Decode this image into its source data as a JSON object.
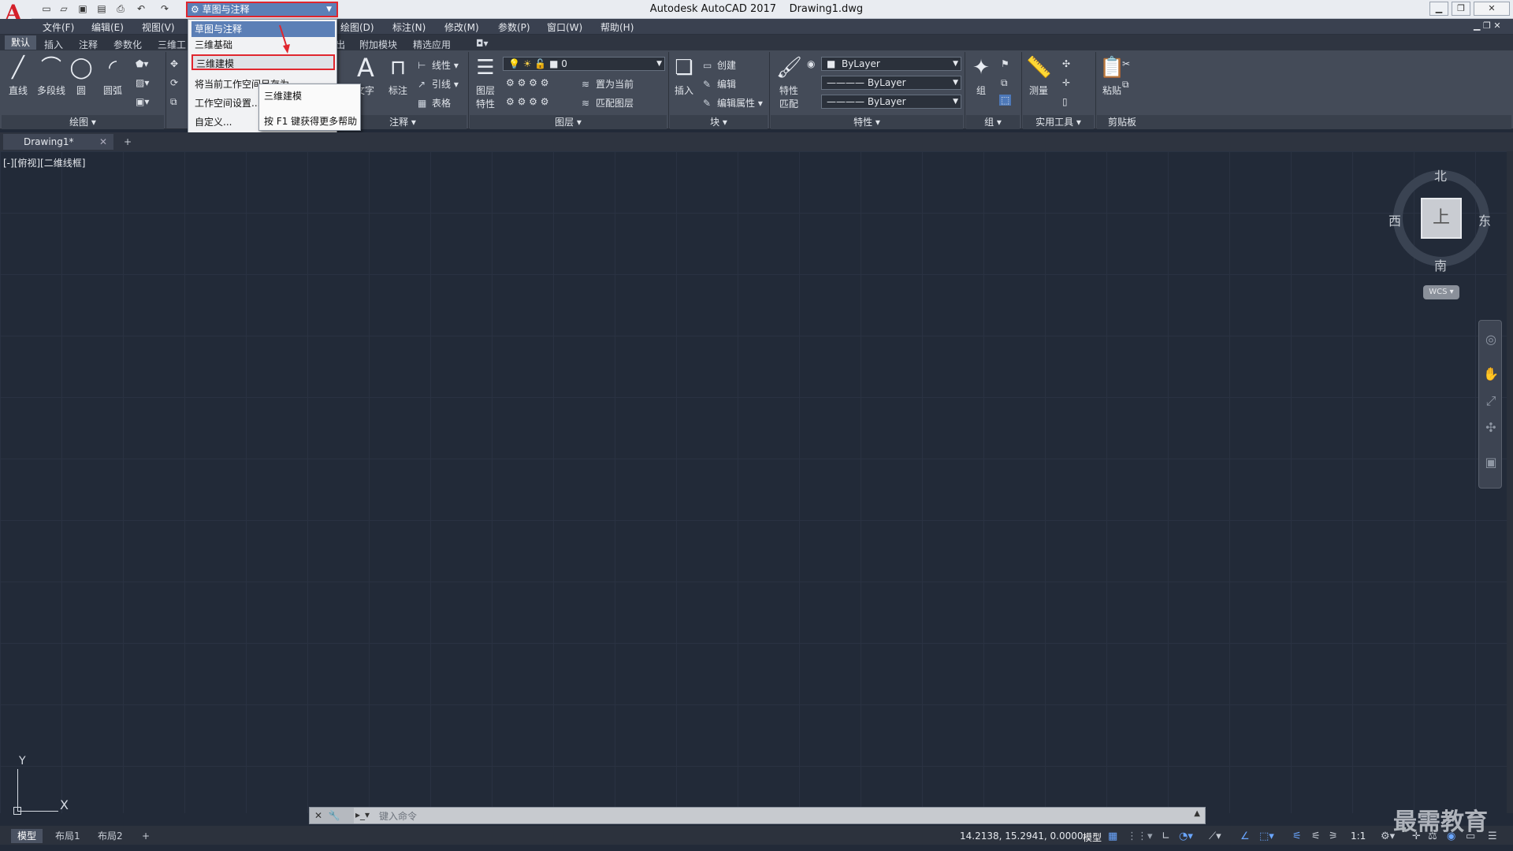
{
  "app": {
    "title": "Autodesk AutoCAD 2017",
    "file": "Drawing1.dwg"
  },
  "workspace": {
    "current": "草图与注释"
  },
  "menu": [
    "文件(F)",
    "编辑(E)",
    "视图(V)",
    "绘图(D)",
    "标注(N)",
    "修改(M)",
    "参数(P)",
    "窗口(W)",
    "帮助(H)"
  ],
  "ribbon_tabs": [
    "默认",
    "插入",
    "注释",
    "参数化",
    "三维工",
    "输出",
    "附加模块",
    "精选应用"
  ],
  "dropdown": {
    "items": [
      "草图与注释",
      "三维基础",
      "三维建模",
      "将当前工作空间另存为...",
      "工作空间设置...",
      "自定义..."
    ],
    "tooltip_title": "三维建模",
    "tooltip_help": "按 F1 键获得更多帮助"
  },
  "ribbon": {
    "draw": {
      "line": "直线",
      "polyline": "多段线",
      "circle": "圆",
      "arc": "圆弧",
      "panel": "绘图"
    },
    "annotation": {
      "text": "文字",
      "dim": "标注",
      "linear": "线性",
      "leader": "引线",
      "table": "表格",
      "panel": "注释"
    },
    "layers": {
      "props_line1": "图层",
      "props_line2": "特性",
      "current_layer": "0",
      "set_current": "置为当前",
      "match": "匹配图层",
      "panel": "图层"
    },
    "block": {
      "insert": "插入",
      "create": "创建",
      "edit": "编辑",
      "edit_attr": "编辑属性",
      "panel": "块"
    },
    "properties": {
      "match_line1": "特性",
      "match_line2": "匹配",
      "color": "ByLayer",
      "linetype": "ByLayer",
      "lineweight": "ByLayer",
      "panel": "特性"
    },
    "groups": {
      "group": "组",
      "panel": "组"
    },
    "utilities": {
      "measure": "测量",
      "panel": "实用工具"
    },
    "clipboard": {
      "paste": "粘贴",
      "panel": "剪贴板"
    }
  },
  "doc_tab": "Drawing1*",
  "viewport_label": "[-][俯视][二维线框]",
  "viewcube": {
    "n": "北",
    "s": "南",
    "e": "东",
    "w": "西",
    "face": "上",
    "wcs": "WCS"
  },
  "ucs": {
    "x": "X",
    "y": "Y"
  },
  "command": {
    "placeholder": "键入命令"
  },
  "layout_tabs": [
    "模型",
    "布局1",
    "布局2"
  ],
  "status": {
    "coords": "14.2138, 15.2941, 0.0000",
    "model": "模型",
    "scale": "1:1"
  },
  "watermark": "最需教育"
}
